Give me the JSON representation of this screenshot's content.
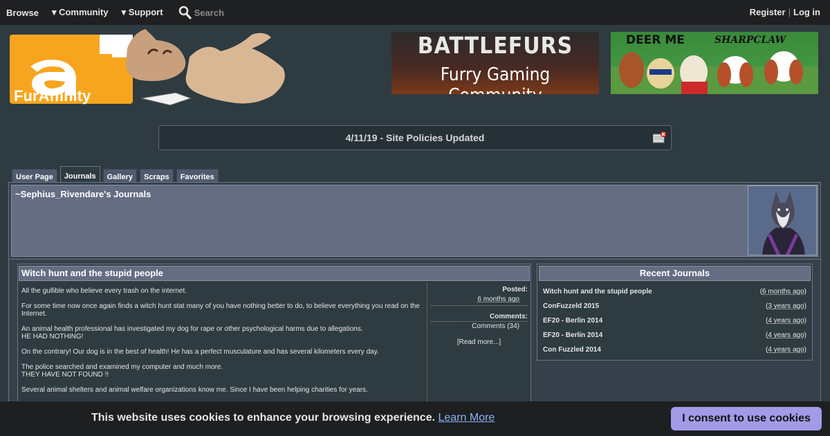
{
  "nav": {
    "browse": "Browse",
    "community": "▾ Community",
    "support": "▾ Support",
    "search_placeholder": "Search",
    "register": "Register",
    "separator": "|",
    "login": "Log in"
  },
  "logo": {
    "text": "FurAffinity"
  },
  "banners": [
    {
      "line1": "BATTLEFURS",
      "line2": "Furry Gaming Community"
    },
    {
      "line1": "DEER ME",
      "line2": "SHARPCLAW"
    }
  ],
  "notice": {
    "text": "4/11/19 - Site Policies Updated"
  },
  "tabs": [
    "User Page",
    "Journals",
    "Gallery",
    "Scraps",
    "Favorites"
  ],
  "active_tab": "Journals",
  "user": {
    "heading": "~Sephius_Rivendare's Journals"
  },
  "journal": {
    "title": "Witch hunt and the stupid people",
    "paragraphs": [
      "All the gullible who believe every trash on the internet.",
      "For some time now once again finds a witch hunt stat many of you have nothing better to do, to believe everything you read on the Internet.",
      "An animal health professional has investigated my dog for rape or other psychological harms due to allegations.",
      "HE HAD NOTHING!",
      "On the contrary! Our dog is in the best of health! He has a perfect musculature and has several kilometers every day.",
      "The police searched and examined my computer and much more.",
      "THEY HAVE NOT FOUND !!",
      "Several animal shelters and animal welfare organizations know me. Since I have been helping charities for years."
    ],
    "posted_label": "Posted:",
    "posted_value": "6 months ago",
    "comments_label": "Comments:",
    "comments_value": "Comments (34)",
    "read_more": "[Read more...]"
  },
  "recent": {
    "title": "Recent Journals",
    "items": [
      {
        "name": "Witch hunt and the stupid people",
        "ago": "6 months ago"
      },
      {
        "name": "ConFuzzeld 2015",
        "ago": "3 years ago"
      },
      {
        "name": "EF20 - Berlin 2014",
        "ago": "4 years ago"
      },
      {
        "name": "EF20 - Berlin 2014",
        "ago": "4 years ago"
      },
      {
        "name": "Con Fuzzled 2014",
        "ago": "4 years ago"
      }
    ]
  },
  "cookie": {
    "message": "This website uses cookies to enhance your browsing experience.",
    "learn_more": "Learn More",
    "consent": "I consent to use cookies"
  },
  "colors": {
    "background": "#2e3b41",
    "nav": "#1f2022",
    "panel": "#646d82",
    "cookie_button": "#a29be8",
    "logo_orange": "#f7a51e"
  }
}
